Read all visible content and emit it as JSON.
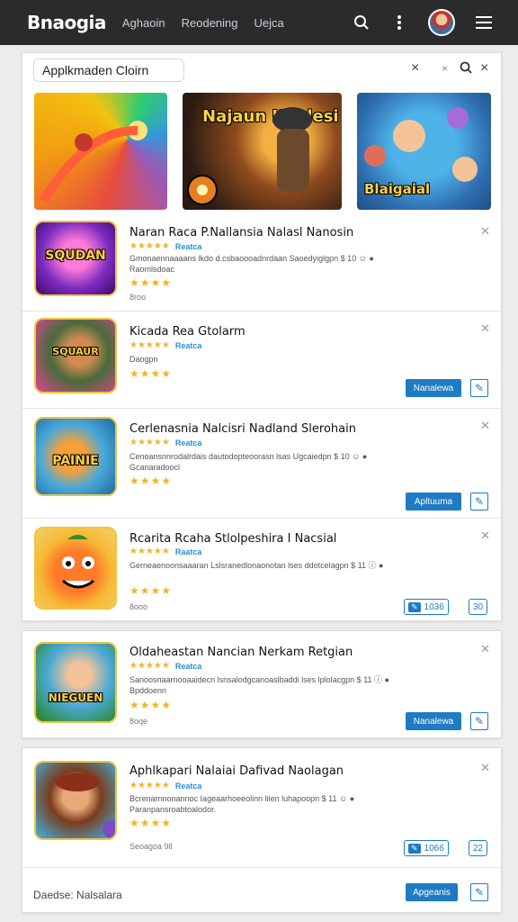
{
  "topbar": {
    "brand": "Bnaogia",
    "nav": [
      "Aghaoin",
      "Reodening",
      "Uejca"
    ],
    "icons": [
      "search-icon",
      "more-vertical-icon",
      "avatar",
      "menu-icon"
    ]
  },
  "search": {
    "value": "Applkmaden Cloirn",
    "close_glyph": "×"
  },
  "featured": [
    {
      "label": ""
    },
    {
      "label": "Najaun Khalesi"
    },
    {
      "label": "Blaigaial"
    }
  ],
  "apps": [
    {
      "title": "Naran Raca P.Nallansia Nalasl Nanosin",
      "badge": "Reatca",
      "desc1": "Gmonaennaaaans lkdo d.csbaoooadnrdaan  Saoedyiglgpn  $ 10  ☺  ●",
      "desc2": "Raomlsdoac",
      "meta": "8roo",
      "icon_label": "SQUDAN",
      "action": "",
      "rating": 4
    },
    {
      "title": "Kicada Rea Gtolarm",
      "badge": "Reatca",
      "desc1": "Daogpn",
      "desc2": "",
      "meta": "",
      "icon_label": "SQUAUR",
      "action": "Nanalewa",
      "rating": 4
    },
    {
      "title": "Cerlenasnia Nalcisri Nadland Slerohain",
      "badge": "Reatca",
      "desc1": "Cenoansnnrodalrdais  dautodopteoorasn  lsas  Ugcaiedpn  $ 10  ☺  ●",
      "desc2": "Gcanaradoocl",
      "meta": "",
      "icon_label": "PAINIE",
      "action": "Apltuuma",
      "rating": 4
    },
    {
      "title": "Rcarita Rcaha Stlolpeshira I Nacsial",
      "badge": "Raatca",
      "desc1": "Gerneaenoonsaaaran  Lslsranedlonaonotan  lses  ddotcelagpn  $ 11  ⓘ  ●",
      "desc2": "",
      "meta": "8ooo",
      "icon_label": "",
      "action": "",
      "pill": "1036",
      "pill_extra": "30",
      "rating": 4
    },
    {
      "title": "Oldaheastan Nancian Nerkam Retgian",
      "badge": "Reatca",
      "desc1": "Sanoosnaarnooaaidecn  lsnsalodgcanoaslbaddi  lses  lplolacgpn  $ 11  ⓘ  ●",
      "desc2": "Bpddoenn",
      "meta": "8oqe",
      "icon_label": "NIEGUEN",
      "action": "Nanalewa",
      "rating": 4
    },
    {
      "title": "Aphlkapari Nalaiai Dafivad Naolagan",
      "badge": "Reatca",
      "desc1": "Bcrenarnnonannoc  Iageaarhoeeolinn  lilen  luhapoopn  $ 11  ☺  ●",
      "desc2": "Paranpansroabtoalodor.",
      "meta": "Seoagoa 9ll",
      "icon_label": "",
      "action": "",
      "pill": "1066",
      "pill_extra": "22",
      "rating": 4
    }
  ],
  "footer": {
    "label": "Daedse: Nalsalara",
    "action": "Apgeanis"
  },
  "colors": {
    "topbar": "#2b2b2d",
    "accent": "#1e7bc4",
    "star": "#f0b429",
    "badge": "#2a8fd6"
  }
}
